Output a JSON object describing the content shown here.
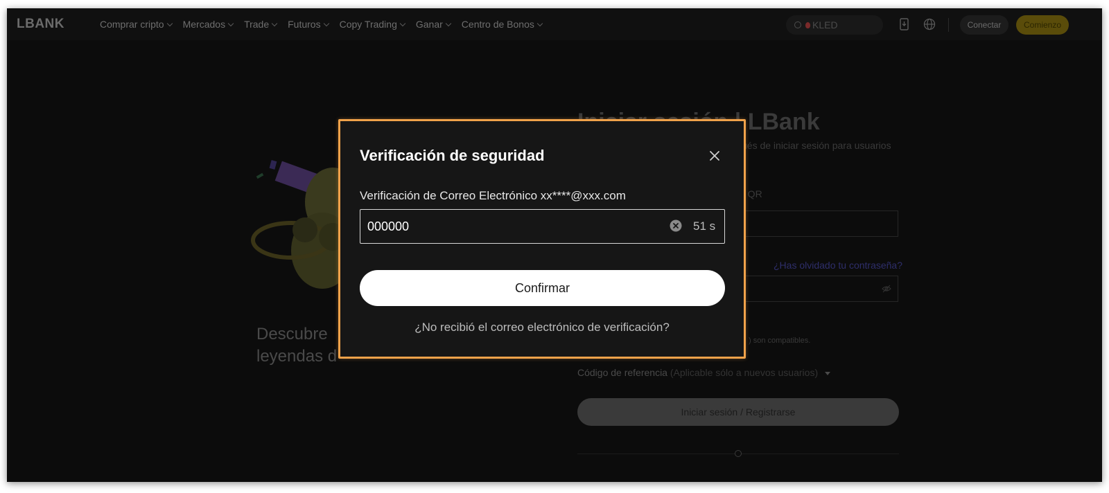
{
  "nav": {
    "logo": "LBANK",
    "menu": [
      {
        "label": "Comprar cripto"
      },
      {
        "label": "Mercados"
      },
      {
        "label": "Trade"
      },
      {
        "label": "Futuros"
      },
      {
        "label": "Copy Trading"
      },
      {
        "label": "Ganar"
      },
      {
        "label": "Centro de Bonos"
      }
    ],
    "search_keyword": "KLED",
    "connect_label": "Conectar",
    "start_label": "Comienzo"
  },
  "background": {
    "promo_line1": "Descubre",
    "promo_line2": "leyendas d",
    "login_title": "Iniciar sesión | LBank",
    "login_subtitle": "ués de iniciar sesión para usuarios",
    "qr_label": "o QR",
    "forgot_password": "¿Has olvidado tu contraseña?",
    "compat_note": ") son compatibles.",
    "referral_label": "Código de referencia",
    "referral_hint": "(Aplicable sólo a nuevos usuarios)",
    "login_button": "Iniciar sesión / Registrarse"
  },
  "modal": {
    "title": "Verificación de seguridad",
    "field_label": "Verificación de Correo Electrónico xx****@xxx.com",
    "code_value": "000000",
    "countdown": "51 s",
    "confirm_label": "Confirmar",
    "resend_link": "¿No recibió el correo electrónico de verificación?"
  },
  "colors": {
    "modal_highlight": "#f0a24a",
    "brand_yellow": "#5a4c0a",
    "modal_bg": "#161616"
  },
  "icons": [
    "search-icon",
    "fire-icon",
    "download-app-icon",
    "globe-icon",
    "close-icon",
    "clear-icon",
    "eye-off-icon"
  ]
}
